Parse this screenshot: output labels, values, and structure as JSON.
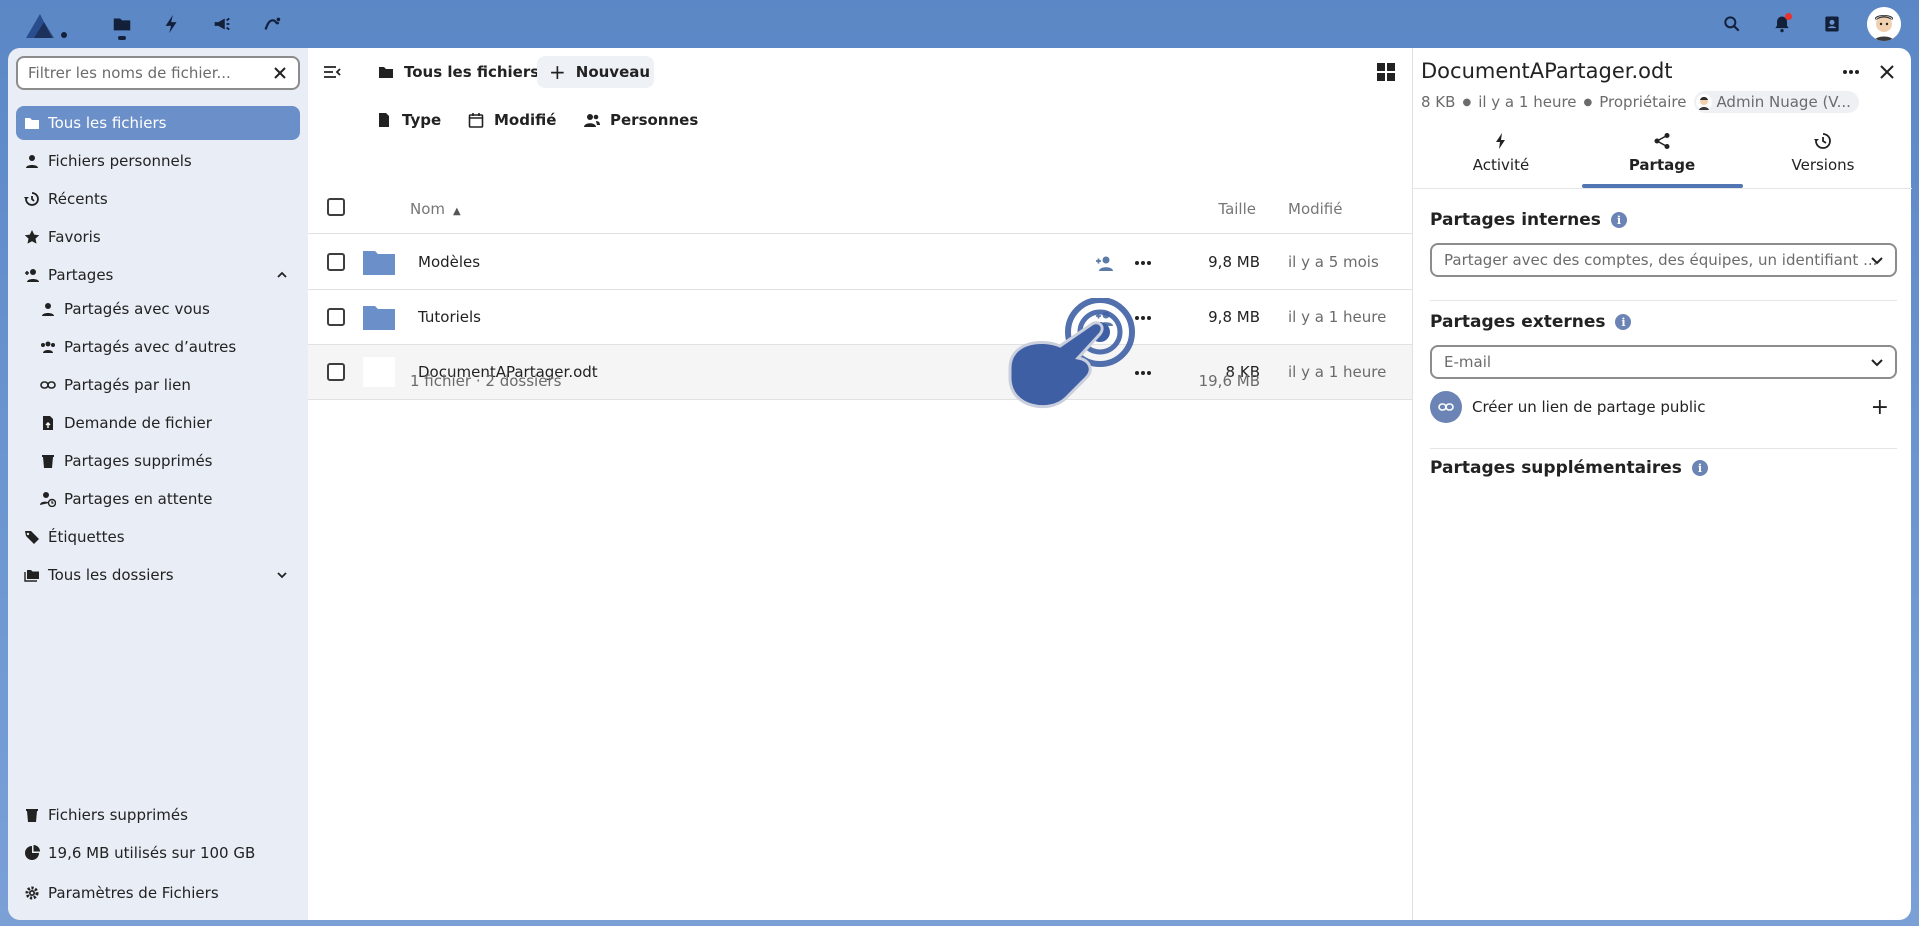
{
  "sidebar": {
    "filter_placeholder": "Filtrer les noms de fichier...",
    "items": [
      {
        "label": "Tous les fichiers",
        "icon": "folder-icon"
      },
      {
        "label": "Fichiers personnels",
        "icon": "user-icon"
      },
      {
        "label": "Récents",
        "icon": "history-icon"
      },
      {
        "label": "Favoris",
        "icon": "star-icon"
      },
      {
        "label": "Partages",
        "icon": "share-user-icon"
      },
      {
        "label": "Partagés avec vous",
        "icon": "user-icon"
      },
      {
        "label": "Partagés avec d’autres",
        "icon": "group-icon"
      },
      {
        "label": "Partagés par lien",
        "icon": "link-icon"
      },
      {
        "label": "Demande de fichier",
        "icon": "file-upload-icon"
      },
      {
        "label": "Partages supprimés",
        "icon": "trash-icon"
      },
      {
        "label": "Partages en attente",
        "icon": "account-clock-icon"
      },
      {
        "label": "Étiquettes",
        "icon": "tag-icon"
      },
      {
        "label": "Tous les dossiers",
        "icon": "folders-icon"
      }
    ],
    "footer": {
      "deleted": "Fichiers supprimés",
      "quota": "19,6 MB utilisés sur 100 GB",
      "settings": "Paramètres de Fichiers"
    }
  },
  "toolbar": {
    "breadcrumb_home": "Tous les fichiers",
    "new_label": "Nouveau",
    "filters": [
      "Type",
      "Modifié",
      "Personnes"
    ]
  },
  "table": {
    "headers": {
      "name": "Nom",
      "size": "Taille",
      "modified": "Modifié"
    },
    "rows": [
      {
        "name": "Modèles",
        "size": "9,8 MB",
        "modified": "il y a 5 mois",
        "type": "folder"
      },
      {
        "name": "Tutoriels",
        "size": "9,8 MB",
        "modified": "il y a 1 heure",
        "type": "folder"
      },
      {
        "name": "DocumentAPartager.odt",
        "size": "8 KB",
        "modified": "il y a 1 heure",
        "type": "file"
      }
    ],
    "summary": "1 fichier · 2 dossiers",
    "summary_size": "19,6 MB"
  },
  "details": {
    "title": "DocumentAPartager.odt",
    "size": "8 KB",
    "time": "il y a 1 heure",
    "owner_label": "Propriétaire",
    "owner_name": "Admin Nuage (V...",
    "tabs": [
      "Activité",
      "Partage",
      "Versions"
    ],
    "internal_title": "Partages internes",
    "internal_placeholder": "Partager avec des comptes, des équipes, un identifiant ...",
    "external_title": "Partages externes",
    "external_placeholder": "E-mail",
    "public_link": "Créer un lien de partage public",
    "additional_title": "Partages supplémentaires"
  },
  "colors": {
    "accent": "#6b8fc9",
    "tab_underline": "#5276b4",
    "folder": "#6b8fc9"
  }
}
